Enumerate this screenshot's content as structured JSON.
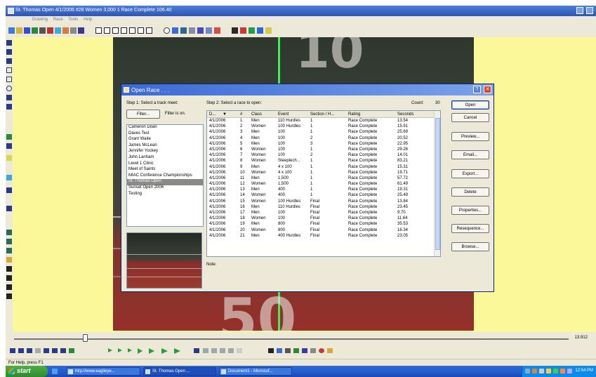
{
  "window": {
    "title": "St. Thomas Open   4/1/2006   #28   Women   3,000   1   Race Complete   106.40"
  },
  "menu": [
    "Drawing",
    "Race",
    "Tools",
    "Help"
  ],
  "dialog": {
    "title": "Open Race . . .",
    "step1_label": "Step 1: Select a track meet:",
    "filter_button": "Filter...",
    "filter_status": "Filter is on.",
    "step2_label": "Step 2: Select a race to open:",
    "count_label": "Count:",
    "count_value": "30",
    "note_label": "Note:",
    "meets": [
      "Cameron Doan",
      "Daves Test",
      "Grant Waite",
      "James McLean",
      "Jennifer Yockey",
      "John Lanham",
      "Level 1 Clinic",
      "Meet of Saints",
      "MIAC Conference Championships",
      "St. Thomas Open",
      "Sunset Open 2006",
      "Testing"
    ],
    "selected_meet": "St. Thomas Open",
    "columns": {
      "date": "D...",
      "num": "#",
      "class": "Class",
      "event": "Event",
      "section": "Section / H...",
      "rating": "Rating",
      "seconds": "Seconds"
    },
    "races": [
      {
        "date": "4/1/2006",
        "num": "1",
        "class": "Men",
        "event": "110 Hurdles",
        "section": "1",
        "rating": "Race Complete",
        "seconds": "13.54"
      },
      {
        "date": "4/1/2006",
        "num": "2",
        "class": "Women",
        "event": "100 Hurdles",
        "section": "1",
        "rating": "Race Complete",
        "seconds": "15.91"
      },
      {
        "date": "4/1/2006",
        "num": "3",
        "class": "Men",
        "event": "100",
        "section": "1",
        "rating": "Race Complete",
        "seconds": "25.69"
      },
      {
        "date": "4/1/2006",
        "num": "4",
        "class": "Men",
        "event": "100",
        "section": "2",
        "rating": "Race Complete",
        "seconds": "20.52"
      },
      {
        "date": "4/1/2006",
        "num": "5",
        "class": "Men",
        "event": "100",
        "section": "3",
        "rating": "Race Complete",
        "seconds": "22.95"
      },
      {
        "date": "4/1/2006",
        "num": "6",
        "class": "Women",
        "event": "100",
        "section": "1",
        "rating": "Race Complete",
        "seconds": "29.26"
      },
      {
        "date": "4/1/2006",
        "num": "7",
        "class": "Women",
        "event": "100",
        "section": "2",
        "rating": "Race Complete",
        "seconds": "14.01"
      },
      {
        "date": "4/1/2006",
        "num": "8",
        "class": "Women",
        "event": "Steeplech...",
        "section": "1",
        "rating": "Race Complete",
        "seconds": "83.21"
      },
      {
        "date": "4/1/2006",
        "num": "9",
        "class": "Men",
        "event": "4 x 100",
        "section": "1",
        "rating": "Race Complete",
        "seconds": "15.31"
      },
      {
        "date": "4/1/2006",
        "num": "10",
        "class": "Women",
        "event": "4 x 100",
        "section": "1",
        "rating": "Race Complete",
        "seconds": "19.71"
      },
      {
        "date": "4/1/2006",
        "num": "11",
        "class": "Men",
        "event": "1,500",
        "section": "1",
        "rating": "Race Complete",
        "seconds": "57.72"
      },
      {
        "date": "4/1/2006",
        "num": "12",
        "class": "Women",
        "event": "1,500",
        "section": "1",
        "rating": "Race Complete",
        "seconds": "61.49"
      },
      {
        "date": "4/1/2006",
        "num": "13",
        "class": "Men",
        "event": "400",
        "section": "1",
        "rating": "Race Complete",
        "seconds": "19.31"
      },
      {
        "date": "4/1/2006",
        "num": "14",
        "class": "Women",
        "event": "400",
        "section": "1",
        "rating": "Race Complete",
        "seconds": "25.49"
      },
      {
        "date": "4/1/2006",
        "num": "15",
        "class": "Women",
        "event": "100 Hurdles",
        "section": "Final",
        "rating": "Race Complete",
        "seconds": "13.84"
      },
      {
        "date": "4/1/2006",
        "num": "16",
        "class": "Men",
        "event": "110 Hurdles",
        "section": "Final",
        "rating": "Race Complete",
        "seconds": "23.45"
      },
      {
        "date": "4/1/2006",
        "num": "17",
        "class": "Men",
        "event": "100",
        "section": "Final",
        "rating": "Race Complete",
        "seconds": "9.70"
      },
      {
        "date": "4/1/2006",
        "num": "18",
        "class": "Women",
        "event": "100",
        "section": "Final",
        "rating": "Race Complete",
        "seconds": "11.64"
      },
      {
        "date": "4/1/2006",
        "num": "19",
        "class": "Men",
        "event": "800",
        "section": "Final",
        "rating": "Race Complete",
        "seconds": "35.53"
      },
      {
        "date": "4/1/2006",
        "num": "20",
        "class": "Women",
        "event": "800",
        "section": "Final",
        "rating": "Race Complete",
        "seconds": "16.34"
      },
      {
        "date": "4/1/2006",
        "num": "21",
        "class": "Men",
        "event": "400 Hurdles",
        "section": "Final",
        "rating": "Race Complete",
        "seconds": "23.05"
      }
    ],
    "buttons": {
      "open": "Open",
      "cancel": "Cancel",
      "preview": "Preview...",
      "email": "Email...",
      "export": "Export...",
      "delete": "Delete",
      "properties": "Properties...",
      "resequence": "Resequence...",
      "browse": "Browse..."
    }
  },
  "playback": {
    "time_readout": "13.912"
  },
  "status": {
    "text": "For Help, press F1"
  },
  "taskbar": {
    "start": "start",
    "tasks": [
      "http://www.eaglieye...",
      "St. Thomas Open ...",
      "Document1 - Microsof..."
    ],
    "clock": "12:54 PM"
  }
}
